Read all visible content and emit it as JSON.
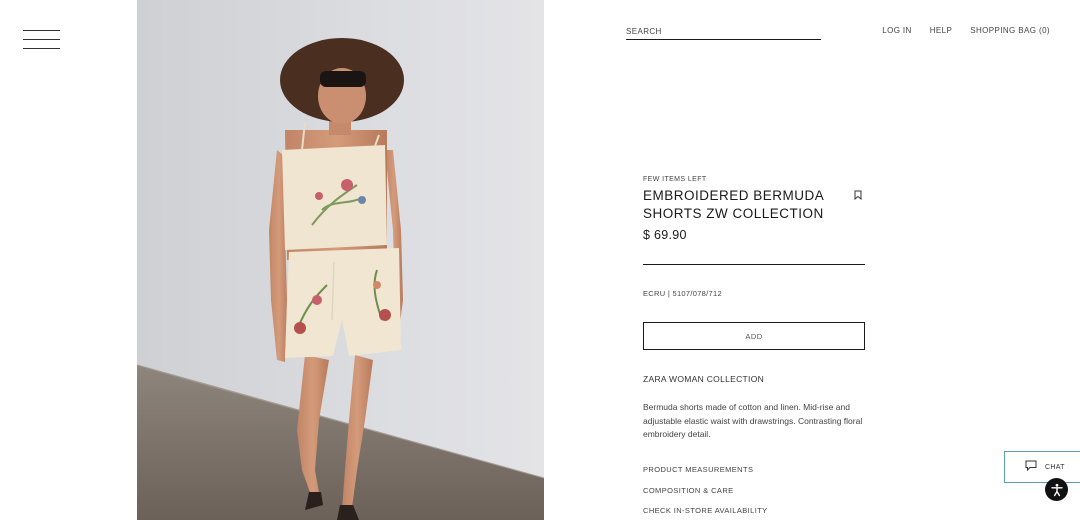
{
  "header": {
    "search_placeholder": "SEARCH",
    "nav": {
      "login": "LOG IN",
      "help": "HELP",
      "bag": "SHOPPING BAG (0)"
    }
  },
  "menu": {
    "icon": "hamburger-menu-icon"
  },
  "product": {
    "badge": "FEW ITEMS LEFT",
    "title_line1": "EMBROIDERED BERMUDA",
    "title_line2": "SHORTS ZW COLLECTION",
    "price": "$ 69.90",
    "color_ref": "ECRU | 5107/078/712",
    "add_label": "ADD",
    "collection": "ZARA WOMAN COLLECTION",
    "description": "Bermuda shorts made of cotton and linen. Mid-rise and adjustable elastic waist with drawstrings. Contrasting floral embroidery detail.",
    "links": [
      "PRODUCT MEASUREMENTS",
      "COMPOSITION & CARE",
      "CHECK IN-STORE AVAILABILITY"
    ]
  },
  "chat": {
    "label": "CHAT",
    "icon": "chat-bubble-icon"
  },
  "accessibility": {
    "icon": "accessibility-icon"
  },
  "colors": {
    "accent_border": "#5a9bb0",
    "text": "#1a1a1a",
    "wall": "#d7d8dc",
    "floor": "#7a6f66"
  }
}
